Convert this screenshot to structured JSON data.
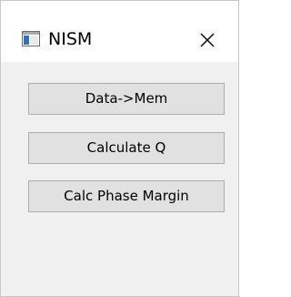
{
  "window": {
    "title": "NISM",
    "app_icon": "window-app-icon",
    "close_icon": "close-icon"
  },
  "buttons": [
    {
      "label": "Data->Mem"
    },
    {
      "label": "Calculate Q"
    },
    {
      "label": "Calc Phase Margin"
    }
  ],
  "colors": {
    "titlebar": "#ffffff",
    "client_area": "#f0f0f0",
    "button_face": "#e1e1e1",
    "button_border": "#adadad",
    "icon_blue": "#2e74b5"
  }
}
